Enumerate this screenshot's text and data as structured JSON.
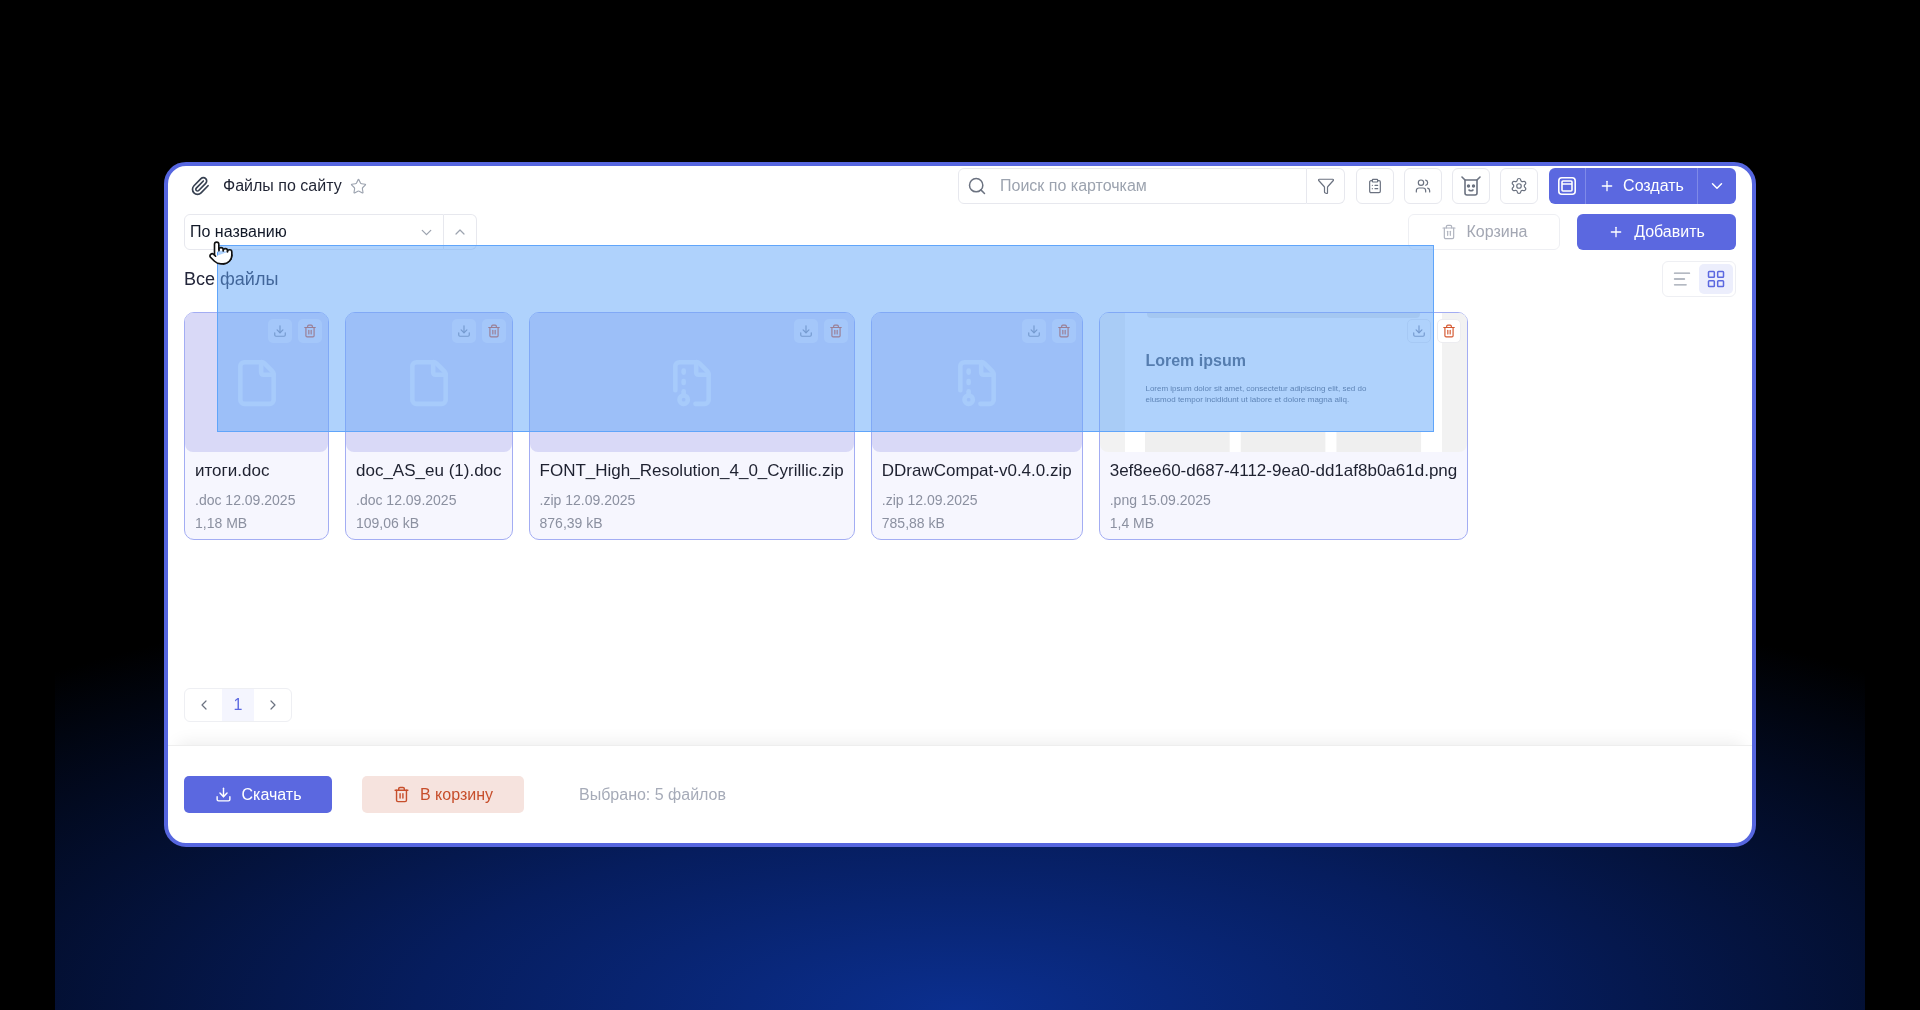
{
  "window": {
    "title": "Файлы по сайту",
    "favorite": false
  },
  "toolbar": {
    "search": {
      "placeholder": "Поиск по карточкам"
    },
    "create_button": {
      "label": "Создать"
    }
  },
  "sort": {
    "value": "По названию",
    "ascending": true
  },
  "actions": {
    "trash_button": {
      "label": "Корзина",
      "disabled": true
    },
    "add_button": {
      "label": "Добавить"
    }
  },
  "section": {
    "title": "Все файлы",
    "view_modes": [
      {
        "kind": "list",
        "selected": false
      },
      {
        "kind": "grid",
        "selected": true
      }
    ]
  },
  "files": [
    {
      "name": "итоги.doc",
      "details": ".doc 12.09.2025",
      "size": "1,18 MB",
      "kind": "document",
      "selected": true
    },
    {
      "name": "doc_AS_eu (1).doc",
      "details": ".doc 12.09.2025",
      "size": "109,06 kB",
      "kind": "document",
      "selected": true
    },
    {
      "name": "FONT_High_Resolution_4_0_Cyrillic.zip",
      "details": ".zip 12.09.2025",
      "size": "876,39 kB",
      "kind": "archive",
      "selected": true
    },
    {
      "name": "DDrawCompat-v0.4.0.zip",
      "details": ".zip 12.09.2025",
      "size": "785,88 kB",
      "kind": "archive",
      "selected": true
    },
    {
      "name": "3ef8ee60-d687-4112-9ea0-dd1af8b0a61d.png",
      "details": ".png 15.09.2025",
      "size": "1,4 MB",
      "kind": "image",
      "selected": true,
      "preview": {
        "title": "Lorem ipsum",
        "text": "Lorem ipsum dolor sit amet, consectetur adipiscing elit, sed do eiusmod tempor incididunt ut labore et dolore magna aliq."
      }
    }
  ],
  "pagination": {
    "pages": [
      {
        "label": "1",
        "selected": true
      }
    ]
  },
  "footer": {
    "download_button": {
      "label": "Скачать"
    },
    "trash_button": {
      "label": "В корзину"
    },
    "status": "Выбрано: 5 файлов"
  },
  "selection_marquee": {
    "visible": true
  }
}
